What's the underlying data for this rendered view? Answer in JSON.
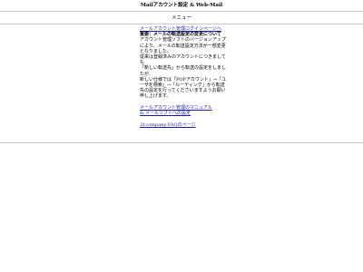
{
  "header": {
    "title": "Mailアカウント設定 & Web-Mail"
  },
  "menu": {
    "label": "メニュー"
  },
  "links": {
    "login": "メールアカウント管理ログインページへ",
    "manual_1": "メールアカウント管理のマニュアル",
    "manual_2": "& メールソフトへの設定",
    "faq": "21company-FAQのページ"
  },
  "notice": {
    "heading": "重要：メールの転送設定の変更について",
    "lines": [
      "アカウント管理ソフトのバージョンアップにより、メールの転送設定方法が一部変更となりました。",
      "従来は登録済みのアカウントにつきましても",
      "「新しい転送先」から転送の設定をしましたが、",
      "新しい仕様では「POPアカウント」→「ユーザを検索」→「ルーティング」から転送先の設定を行ってくださいますようお願い申し上げます。"
    ]
  }
}
